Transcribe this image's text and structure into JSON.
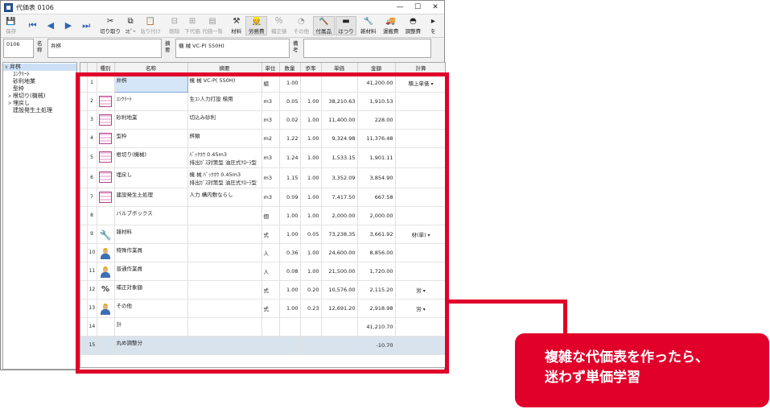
{
  "window": {
    "title": "代価表 0106",
    "controls": [
      "—",
      "☐",
      "✕"
    ]
  },
  "toolbar": [
    {
      "label": "保存",
      "glyph": "💾",
      "state": "disabled",
      "wide": false
    },
    {
      "label": "",
      "glyph": "⏮",
      "state": "nav",
      "wide": false
    },
    {
      "label": "",
      "glyph": "◀",
      "state": "nav",
      "wide": false
    },
    {
      "label": "",
      "glyph": "▶",
      "state": "nav",
      "wide": false
    },
    {
      "label": "",
      "glyph": "⏭",
      "state": "nav",
      "wide": false
    },
    {
      "label": "切り取り",
      "glyph": "✂",
      "state": "",
      "wide": true
    },
    {
      "label": "ｺﾋﾟｰ",
      "glyph": "⧉",
      "state": "",
      "wide": false
    },
    {
      "label": "貼り付け",
      "glyph": "📋",
      "state": "disabled",
      "wide": true
    },
    {
      "label": "削除",
      "glyph": "⊟",
      "state": "disabled",
      "wide": false
    },
    {
      "label": "下代価",
      "glyph": "⊞",
      "state": "disabled",
      "wide": false
    },
    {
      "label": "代価一覧",
      "glyph": "▤",
      "state": "disabled",
      "wide": true
    },
    {
      "label": "材料",
      "glyph": "⚒",
      "state": "",
      "wide": false
    },
    {
      "label": "労務費",
      "glyph": "👷",
      "state": "raised",
      "wide": true
    },
    {
      "label": "補正値",
      "glyph": "％",
      "state": "disabled",
      "wide": true
    },
    {
      "label": "その他",
      "glyph": "◔",
      "state": "disabled",
      "wide": true
    },
    {
      "label": "付属品",
      "glyph": "🔨",
      "state": "raised",
      "wide": true
    },
    {
      "label": "はつり",
      "glyph": "▬",
      "state": "raised",
      "wide": true
    },
    {
      "label": "雑材料",
      "glyph": "🔧",
      "state": "",
      "wide": true
    },
    {
      "label": "運搬費",
      "glyph": "🚚",
      "state": "",
      "wide": true
    },
    {
      "label": "調整費",
      "glyph": "◓",
      "state": "",
      "wide": true
    },
    {
      "label": "を",
      "glyph": "▸",
      "state": "",
      "wide": false
    }
  ],
  "header": {
    "code": "0106",
    "name_label": "名称",
    "name_value": "弁桝",
    "spec_label": "摘要",
    "spec_value": "機 械 VC-P( 550H)",
    "note_label": "備考",
    "note_value": ""
  },
  "tree": [
    {
      "label": "弁桝",
      "level": 0,
      "toggle": "∨"
    },
    {
      "label": "ｺﾝｸﾘｰﾄ",
      "level": 1,
      "toggle": ""
    },
    {
      "label": "砂利地業",
      "level": 1,
      "toggle": ""
    },
    {
      "label": "型枠",
      "level": 1,
      "toggle": ""
    },
    {
      "label": "根切り(機械)",
      "level": 1,
      "toggle": ">"
    },
    {
      "label": "埋戻し",
      "level": 1,
      "toggle": ">"
    },
    {
      "label": "建設発生土処理",
      "level": 1,
      "toggle": ""
    }
  ],
  "grid": {
    "columns": [
      "",
      "",
      "種別",
      "名称",
      "摘要",
      "単位",
      "数量",
      "歩率",
      "単価",
      "金額",
      "計算"
    ],
    "rows": [
      {
        "no": "1",
        "icon": "",
        "name": "弁桝",
        "spec": "機 械 VC-P( 550H)",
        "unit": "組",
        "qty": "1.00",
        "rate": "",
        "price": "",
        "amount": "41,200.00",
        "calc": "積上単価",
        "dd": true
      },
      {
        "no": "2",
        "icon": "grid",
        "name": "ｺﾝｸﾘｰﾄ",
        "spec": "生ｺﾝ人力打設 梯用",
        "unit": "m3",
        "qty": "0.05",
        "rate": "1.00",
        "price": "38,210.63",
        "amount": "1,910.53",
        "calc": "",
        "dd": false
      },
      {
        "no": "3",
        "icon": "grid",
        "name": "砂利地業",
        "spec": "切込み砂利",
        "unit": "m3",
        "qty": "0.02",
        "rate": "1.00",
        "price": "11,400.00",
        "amount": "228.00",
        "calc": "",
        "dd": false
      },
      {
        "no": "4",
        "icon": "grid",
        "name": "型枠",
        "spec": "桝類",
        "unit": "m2",
        "qty": "1.22",
        "rate": "1.00",
        "price": "9,324.98",
        "amount": "11,376.48",
        "calc": "",
        "dd": false
      },
      {
        "no": "5",
        "icon": "grid",
        "name": "根切り(機械)",
        "spec": "ﾊﾞｯｸﾎｳ 0.45m3\n排出ｶﾞｽ対策型 油圧式ｸﾛｰﾗ型",
        "unit": "m3",
        "qty": "1.24",
        "rate": "1.00",
        "price": "1,533.15",
        "amount": "1,901.11",
        "calc": "",
        "dd": false
      },
      {
        "no": "6",
        "icon": "grid",
        "name": "埋戻し",
        "spec": "機 械 ﾊﾞｯｸﾎｳ 0.45m3\n排出ｶﾞｽ対策型 油圧式ｸﾛｰﾗ型",
        "unit": "m3",
        "qty": "1.15",
        "rate": "1.00",
        "price": "3,352.09",
        "amount": "3,854.90",
        "calc": "",
        "dd": false
      },
      {
        "no": "7",
        "icon": "grid",
        "name": "建設発生土処理",
        "spec": "人力 構内敷ならし",
        "unit": "m3",
        "qty": "0.09",
        "rate": "1.00",
        "price": "7,417.50",
        "amount": "667.58",
        "calc": "",
        "dd": false
      },
      {
        "no": "8",
        "icon": "",
        "name": "バルブボックス",
        "spec": "",
        "unit": "個",
        "qty": "1.00",
        "rate": "1.00",
        "price": "2,000.00",
        "amount": "2,000.00",
        "calc": "",
        "dd": false
      },
      {
        "no": "9",
        "icon": "wrench",
        "name": "雑材料",
        "spec": "",
        "unit": "式",
        "qty": "1.00",
        "rate": "0.05",
        "price": "73,238.35",
        "amount": "3,661.92",
        "calc": "材(単)",
        "dd": true
      },
      {
        "no": "10",
        "icon": "person",
        "name": "特殊作業員",
        "spec": "",
        "unit": "人",
        "qty": "0.36",
        "rate": "1.00",
        "price": "24,600.00",
        "amount": "8,856.00",
        "calc": "",
        "dd": false
      },
      {
        "no": "11",
        "icon": "person",
        "name": "普通作業員",
        "spec": "",
        "unit": "人",
        "qty": "0.08",
        "rate": "1.00",
        "price": "21,500.00",
        "amount": "1,720.00",
        "calc": "",
        "dd": false
      },
      {
        "no": "12",
        "icon": "pct",
        "name": "補正対象額",
        "spec": "",
        "unit": "式",
        "qty": "1.00",
        "rate": "0.20",
        "price": "10,576.00",
        "amount": "2,115.20",
        "calc": "労",
        "dd": true
      },
      {
        "no": "13",
        "icon": "person",
        "name": "その他",
        "spec": "",
        "unit": "式",
        "qty": "1.00",
        "rate": "0.23",
        "price": "12,691.20",
        "amount": "2,918.98",
        "calc": "労",
        "dd": true
      },
      {
        "no": "14",
        "icon": "",
        "name": "計",
        "spec": "",
        "unit": "",
        "qty": "",
        "rate": "",
        "price": "",
        "amount": "41,210.70",
        "calc": "",
        "dd": false
      },
      {
        "no": "15",
        "icon": "",
        "name": "丸め調整分",
        "spec": "",
        "unit": "",
        "qty": "",
        "rate": "",
        "price": "",
        "amount": "-10.70",
        "calc": "",
        "dd": false
      }
    ]
  },
  "callout": {
    "line1": "複雑な代価表を作ったら、",
    "line2": "迷わず単価学習"
  },
  "colors": {
    "accent": "#e0002a",
    "selected": "#d4e6f7",
    "tree_selected": "#cce0f5"
  }
}
